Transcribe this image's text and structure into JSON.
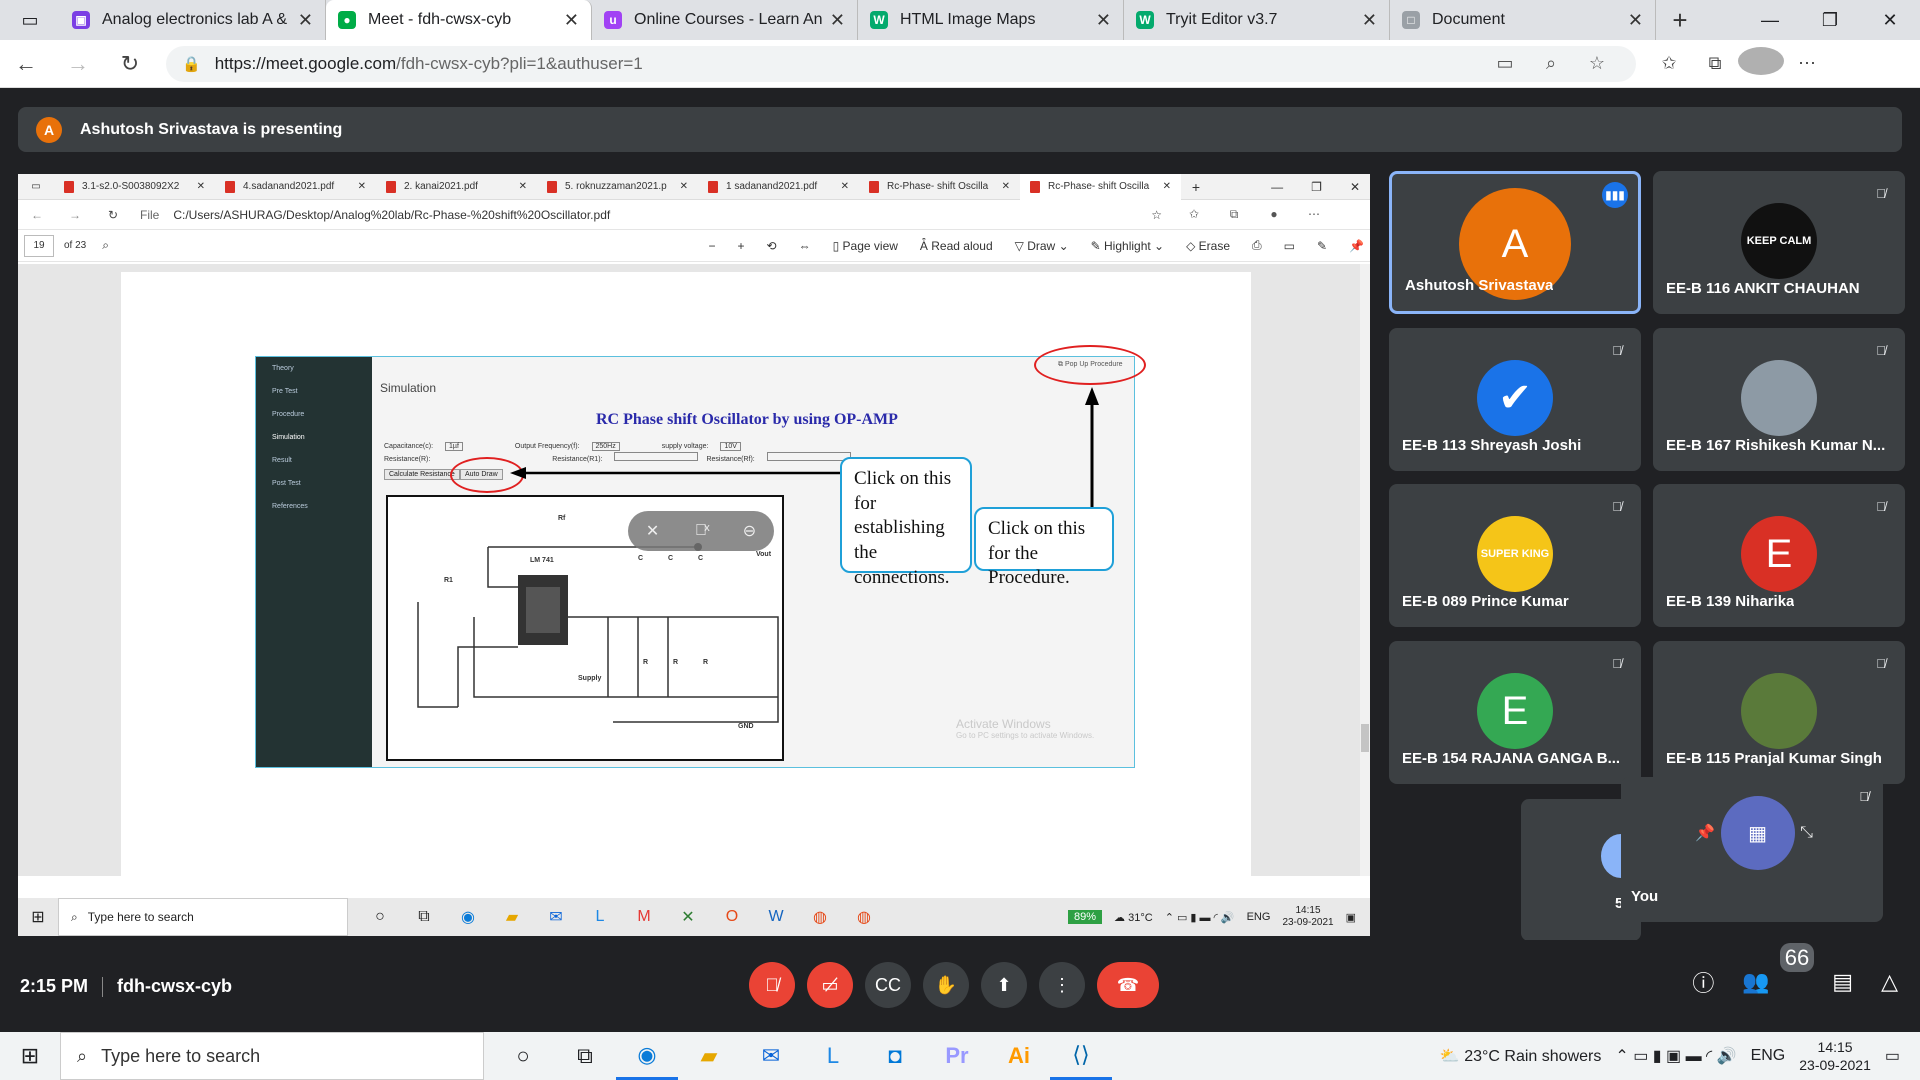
{
  "browser": {
    "tabs": [
      {
        "label": "Analog electronics lab A & I",
        "color": "#7b3fe4",
        "glyph": "▣",
        "active": false
      },
      {
        "label": "Meet - fdh-cwsx-cyb",
        "color": "#00ac47",
        "glyph": "●",
        "active": true
      },
      {
        "label": "Online Courses - Learn Anyt",
        "color": "#a142f4",
        "glyph": "u",
        "active": false
      },
      {
        "label": "HTML Image Maps",
        "color": "#04aa6d",
        "glyph": "W",
        "active": false
      },
      {
        "label": "Tryit Editor v3.7",
        "color": "#04aa6d",
        "glyph": "W",
        "active": false
      },
      {
        "label": "Document",
        "color": "#9aa0a6",
        "glyph": "□",
        "active": false
      }
    ],
    "url_host": "https://meet.google.com",
    "url_rest": "/fdh-cwsx-cyb?pli=1&authuser=1"
  },
  "meet": {
    "presenter_initial": "A",
    "presenting_text": "Ashutosh Srivastava is presenting",
    "time": "2:15 PM",
    "meeting_code": "fdh-cwsx-cyb",
    "participant_count": "66",
    "you_label": "You",
    "hidden_count": "5"
  },
  "participants": [
    {
      "name": "Ashutosh Srivastava",
      "initial": "A",
      "bg": "#e8710a",
      "speaking": true
    },
    {
      "name": "EE-B 116 ANKIT CHAUHAN",
      "initial": "KEEP CALM",
      "bg": "#111111",
      "speaking": false
    },
    {
      "name": "EE-B 113 Shreyash Joshi",
      "initial": "✔",
      "bg": "#1a73e8",
      "speaking": false
    },
    {
      "name": "EE-B 167 Rishikesh Kumar N...",
      "initial": "",
      "bg": "#8d9aa5",
      "speaking": false
    },
    {
      "name": "EE-B 089 Prince Kumar",
      "initial": "SUPER KING",
      "bg": "#f5c518",
      "speaking": false
    },
    {
      "name": "EE-B 139 Niharika",
      "initial": "E",
      "bg": "#d93025",
      "speaking": false
    },
    {
      "name": "EE-B 154 RAJANA GANGA B...",
      "initial": "E",
      "bg": "#34a853",
      "speaking": false
    },
    {
      "name": "EE-B 115 Pranjal Kumar Singh",
      "initial": "",
      "bg": "#5a7a3a",
      "speaking": false
    }
  ],
  "shared": {
    "tabs": [
      "3.1-s2.0-S0038092X2",
      "4.sadanand2021.pdf",
      "2. kanai2021.pdf",
      "5. roknuzzaman2021.p",
      "1 sadanand2021.pdf",
      "Rc-Phase- shift Oscilla",
      "Rc-Phase- shift Oscilla"
    ],
    "file_label": "File",
    "path": "C:/Users/ASHURAG/Desktop/Analog%20lab/Rc-Phase-%20shift%20Oscillator.pdf",
    "page_current": "19",
    "page_total": "of 23",
    "tools": {
      "page_view": "Page view",
      "read_aloud": "Read aloud",
      "draw": "Draw",
      "highlight": "Highlight",
      "erase": "Erase"
    },
    "sim": {
      "menu": [
        "Theory",
        "Pre Test",
        "Procedure",
        "Simulation",
        "Result",
        "Post Test",
        "References"
      ],
      "active_menu": "Simulation",
      "section": "Simulation",
      "heading": "RC Phase shift Oscillator by using OP-AMP",
      "capacitance": "Capacitance(c):",
      "capacitance_val": "1µf",
      "out_freq": "Output Frequency(f):",
      "out_freq_val": "250Hz",
      "supply": "supply voltage:",
      "supply_val": "10V",
      "resistance": "Resistance(R):",
      "resistance1": "Resistance(R1):",
      "resistance_f": "Resistance(Rf):",
      "calc_btn": "Calculate Resistance",
      "auto_btn": "Auto Draw",
      "popup": "Pop Up Procedure",
      "labels": {
        "rf": "Rf",
        "lm": "LM 741",
        "r1": "R1",
        "vout": "Vout",
        "supply": "Supply",
        "gnd": "GND",
        "c": "C",
        "r": "R"
      },
      "callout1": "Click on this for establishing the connections.",
      "callout2": "Click on this for the Procedure.",
      "watermark1": "Activate Windows",
      "watermark2": "Go to PC settings to activate Windows."
    },
    "taskbar": {
      "search": "Type here to search",
      "battery": "89%",
      "temp": "31°C",
      "lang": "ENG",
      "time": "14:15",
      "date": "23-09-2021"
    }
  },
  "taskbar": {
    "search": "Type here to search",
    "weather": "23°C  Rain showers",
    "lang": "ENG",
    "time": "14:15",
    "date": "23-09-2021"
  }
}
